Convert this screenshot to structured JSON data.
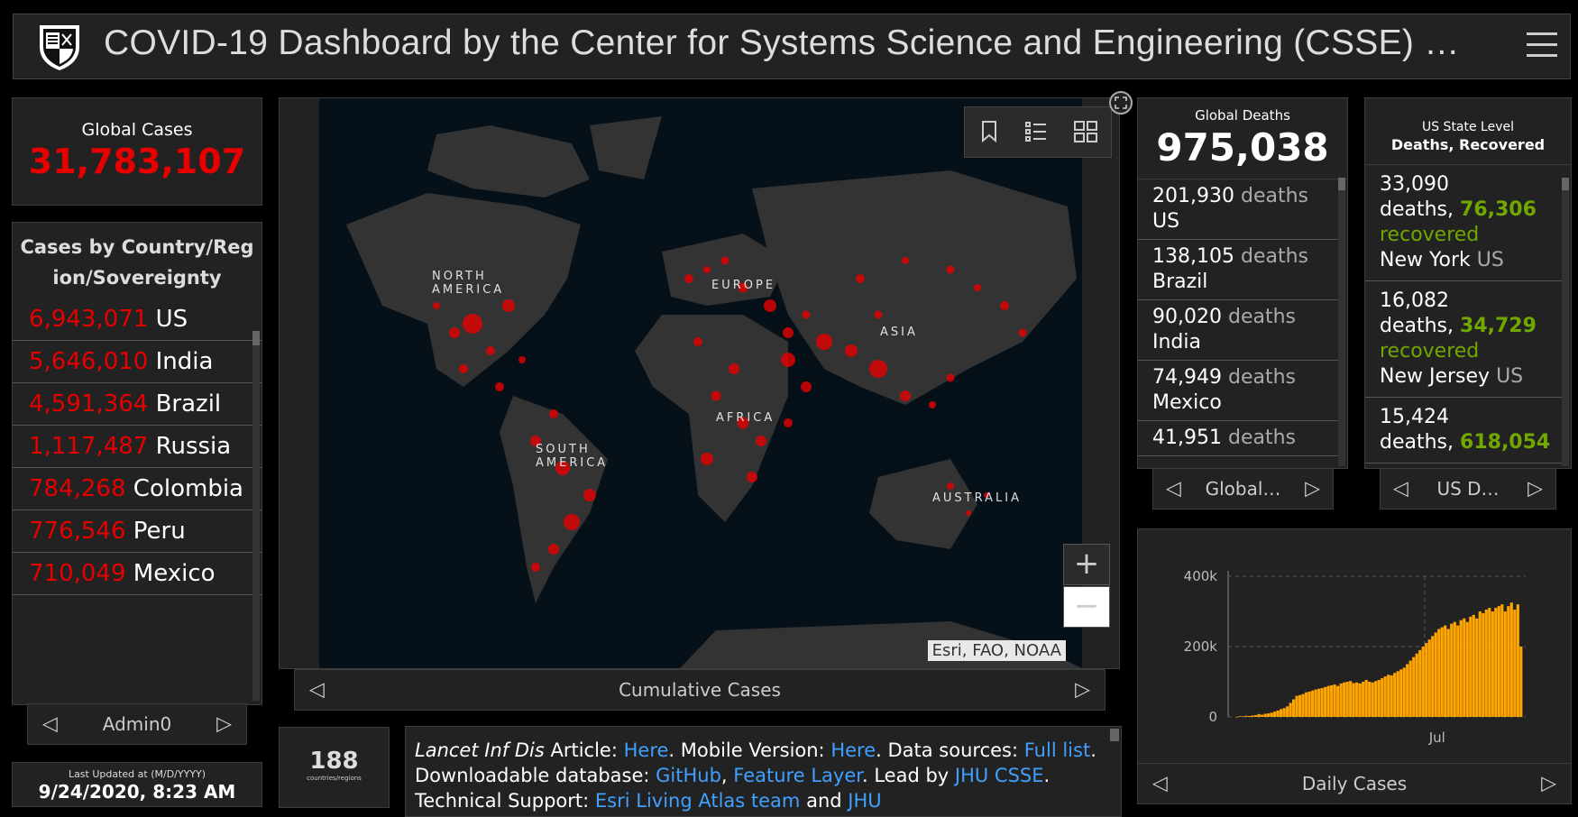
{
  "header": {
    "title": "COVID-19 Dashboard by the Center for Systems Science and Engineering (CSSE) …",
    "logo": "university-shield-logo",
    "menu_icon": "hamburger-menu-icon"
  },
  "global_cases": {
    "label": "Global Cases",
    "value": "31,783,107"
  },
  "cases_by_country": {
    "heading": "Cases by Country/Region/Sovereignty",
    "rows": [
      {
        "value": "6,943,071",
        "name": "US"
      },
      {
        "value": "5,646,010",
        "name": "India"
      },
      {
        "value": "4,591,364",
        "name": "Brazil"
      },
      {
        "value": "1,117,487",
        "name": "Russia"
      },
      {
        "value": "784,268",
        "name": "Colombia"
      },
      {
        "value": "776,546",
        "name": "Peru"
      },
      {
        "value": "710,049",
        "name": "Mexico"
      }
    ],
    "nav_label": "Admin0"
  },
  "last_updated": {
    "label": "Last Updated at (M/D/YYYY)",
    "value": "9/24/2020, 8:23 AM"
  },
  "map": {
    "nav_label": "Cumulative Cases",
    "attribution": "Esri, FAO, NOAA",
    "labels": {
      "north_america": "NORTH AMERICA",
      "europe": "EUROPE",
      "asia": "ASIA",
      "africa": "AFRICA",
      "south_america": "SOUTH AMERICA",
      "australia": "AUSTRALIA"
    },
    "zoom_in": "+",
    "zoom_out": "−"
  },
  "countries": {
    "count": "188",
    "label": "countries/regions"
  },
  "info": {
    "journal": "Lancet Inf Dis",
    "article": "Article:",
    "here1": "Here",
    "mobile": ". Mobile Version:",
    "here2": "Here",
    "sources": ". Data sources:",
    "full_list": "Full list",
    "db": ". Downloadable database:",
    "github": "GitHub",
    "comma": ",",
    "feature_layer": "Feature Layer",
    "period": ".",
    "lead": "Lead by",
    "jhu_csse": "JHU CSSE",
    "support": ". Technical Support:",
    "esri_team": "Esri Living Atlas team",
    "and": "and",
    "jhu": "JHU"
  },
  "global_deaths": {
    "label": "Global Deaths",
    "value": "975,038",
    "rows": [
      {
        "value": "201,930",
        "unit": "deaths",
        "name": "US"
      },
      {
        "value": "138,105",
        "unit": "deaths",
        "name": "Brazil"
      },
      {
        "value": "90,020",
        "unit": "deaths",
        "name": "India"
      },
      {
        "value": "74,949",
        "unit": "deaths",
        "name": "Mexico"
      },
      {
        "value": "41,951",
        "unit": "deaths",
        "name": ""
      }
    ],
    "nav_label": "Global…"
  },
  "us_state": {
    "label": "US State Level",
    "sublabel": "Deaths, Recovered",
    "rows": [
      {
        "deaths": "33,090",
        "deaths_word": "deaths,",
        "recovered": "76,306",
        "recovered_word": "recovered",
        "name": "New York",
        "country": "US"
      },
      {
        "deaths": "16,082",
        "deaths_word": "deaths,",
        "recovered": "34,729",
        "recovered_word": "recovered",
        "name": "New Jersey",
        "country": "US"
      },
      {
        "deaths": "15,424",
        "deaths_word": "deaths,",
        "recovered": "618,054",
        "recovered_word": "",
        "name": "",
        "country": ""
      }
    ],
    "nav_label": "US D…"
  },
  "daily_chart": {
    "nav_label": "Daily Cases"
  },
  "chart_data": {
    "type": "bar",
    "title": "",
    "xlabel": "",
    "ylabel": "",
    "ylim": [
      0,
      400000
    ],
    "y_ticks": [
      "0",
      "200k",
      "400k"
    ],
    "x_tick_labels": [
      "Jul"
    ],
    "color": "#ffa500",
    "values": [
      0,
      2000,
      1500,
      3000,
      2500,
      4000,
      5000,
      8000,
      6000,
      9000,
      10000,
      12000,
      15000,
      18000,
      22000,
      25000,
      30000,
      40000,
      50000,
      60000,
      62000,
      65000,
      70000,
      72000,
      75000,
      78000,
      80000,
      82000,
      85000,
      88000,
      90000,
      92000,
      88000,
      95000,
      98000,
      100000,
      102000,
      96000,
      98000,
      95000,
      100000,
      105000,
      100000,
      98000,
      102000,
      105000,
      110000,
      115000,
      120000,
      118000,
      125000,
      130000,
      135000,
      140000,
      150000,
      160000,
      170000,
      180000,
      190000,
      200000,
      210000,
      220000,
      230000,
      240000,
      250000,
      255000,
      260000,
      250000,
      265000,
      270000,
      260000,
      275000,
      280000,
      270000,
      285000,
      290000,
      280000,
      300000,
      295000,
      305000,
      310000,
      300000,
      310000,
      315000,
      320000,
      300000,
      315000,
      325000,
      305000,
      320000,
      200000
    ]
  }
}
